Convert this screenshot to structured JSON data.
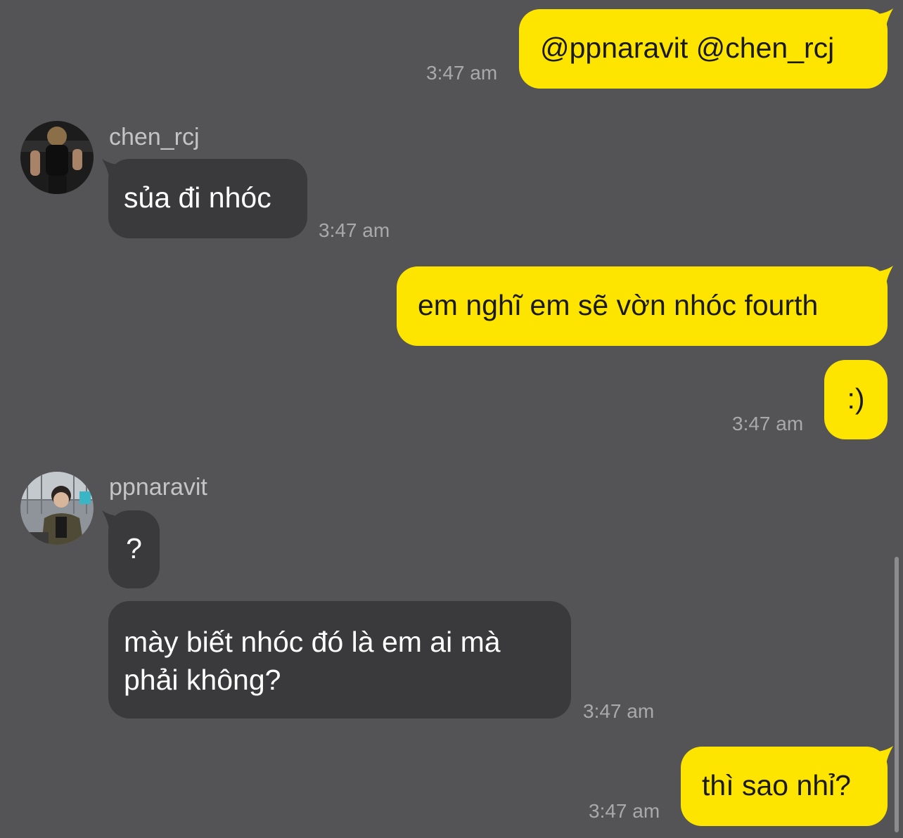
{
  "colors": {
    "background": "#545355",
    "outgoing_bubble": "#FEE500",
    "incoming_bubble": "#3A3A3C",
    "timestamp": "#A9A9AB"
  },
  "messages": [
    {
      "direction": "outgoing",
      "text": "@ppnaravit @chen_rcj",
      "time": "3:47 am"
    },
    {
      "direction": "incoming",
      "sender": "chen_rcj",
      "text": "sủa đi nhóc",
      "time": "3:47 am"
    },
    {
      "direction": "outgoing",
      "text": "em nghĩ em sẽ vờn nhóc fourth",
      "time": ""
    },
    {
      "direction": "outgoing",
      "text": ":)",
      "time": "3:47 am"
    },
    {
      "direction": "incoming",
      "sender": "ppnaravit",
      "text": "?",
      "time": ""
    },
    {
      "direction": "incoming",
      "sender": "ppnaravit",
      "text_line1": "mày biết nhóc đó là em ai mà",
      "text_line2": "phải không?",
      "time": "3:47 am"
    },
    {
      "direction": "outgoing",
      "text": "thì sao nhỉ?",
      "time": "3:47 am"
    }
  ]
}
